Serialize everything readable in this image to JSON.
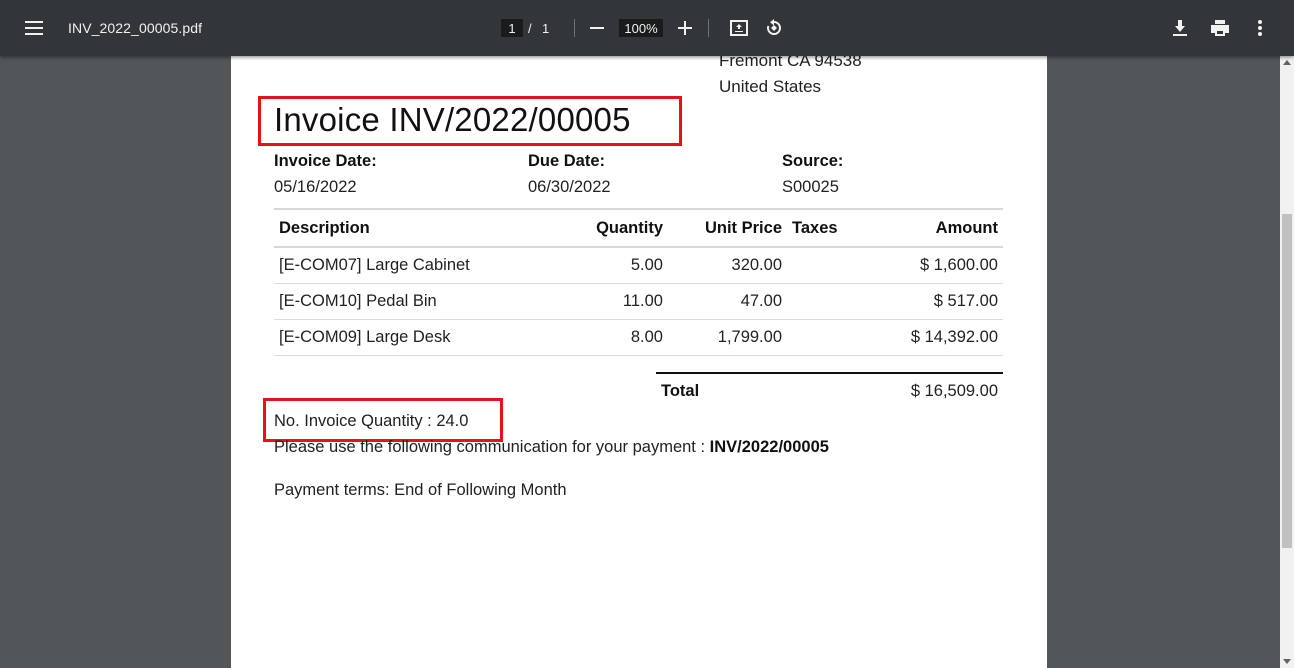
{
  "viewer": {
    "file_name": "INV_2022_00005.pdf",
    "current_page": "1",
    "page_separator": "/",
    "total_pages": "1",
    "zoom_level": "100%",
    "icons": {
      "menu": "menu-icon",
      "zoom_out": "minus-icon",
      "zoom_in": "plus-icon",
      "fit_page": "fit-to-page-icon",
      "rotate": "rotate-icon",
      "download": "download-icon",
      "print": "print-icon",
      "more": "more-vertical-icon"
    },
    "colors": {
      "toolbar_bg": "#323639",
      "viewer_bg": "#525659",
      "highlight": "#e8101a"
    }
  },
  "invoice": {
    "address_lines": [
      "Fremont CA 94538",
      "United States"
    ],
    "title": "Invoice INV/2022/00005",
    "invoice_date_label": "Invoice Date:",
    "invoice_date": "05/16/2022",
    "due_date_label": "Due Date:",
    "due_date": "06/30/2022",
    "source_label": "Source:",
    "source": "S00025",
    "columns": {
      "description": "Description",
      "quantity": "Quantity",
      "unit_price": "Unit Price",
      "taxes": "Taxes",
      "amount": "Amount"
    },
    "lines": [
      {
        "description": "[E-COM07] Large Cabinet",
        "quantity": "5.00",
        "unit_price": "320.00",
        "taxes": "",
        "amount": "$ 1,600.00"
      },
      {
        "description": "[E-COM10] Pedal Bin",
        "quantity": "11.00",
        "unit_price": "47.00",
        "taxes": "",
        "amount": "$ 517.00"
      },
      {
        "description": "[E-COM09] Large Desk",
        "quantity": "8.00",
        "unit_price": "1,799.00",
        "taxes": "",
        "amount": "$ 14,392.00"
      }
    ],
    "total_label": "Total",
    "total_value": "$ 16,509.00",
    "quantity_note": "No. Invoice Quantity : 24.0",
    "communication_text": "Please use the following communication for your payment :",
    "communication_ref": "INV/2022/00005",
    "payment_terms": "Payment terms: End of Following Month"
  }
}
